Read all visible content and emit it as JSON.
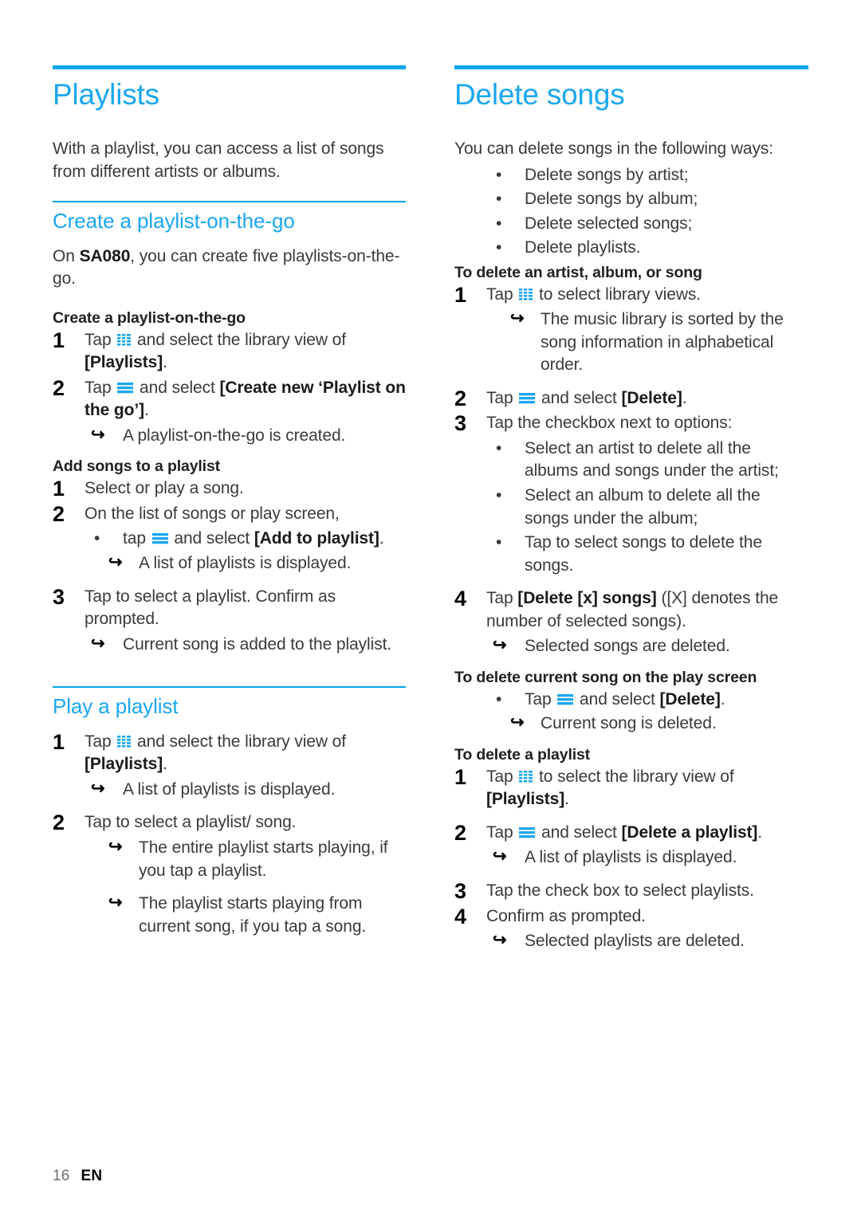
{
  "accent_color": "#00a5ed",
  "heading_color": "#1aa7f0",
  "icons": {
    "grid": "library-views-grid-icon",
    "menu": "options-menu-icon"
  },
  "left_column": {
    "chapter_title": "Playlists",
    "intro": "With a playlist, you can access a list of songs from different artists or albums.",
    "section1": {
      "title": "Create a playlist-on-the-go",
      "lead_pre": "On ",
      "lead_bold": "SA080",
      "lead_post": ", you can create five playlists-on-the-go.",
      "sub1_title": "Create a playlist-on-the-go",
      "sub1_steps": [
        {
          "num": "1",
          "pre": "Tap ",
          "icon": "grid",
          "mid": " and select the library view of ",
          "bold": "[Playlists]",
          "post": "."
        },
        {
          "num": "2",
          "pre": "Tap ",
          "icon": "menu",
          "mid": " and select ",
          "bold": "[Create new ‘Playlist on the go’]",
          "post": "."
        }
      ],
      "sub1_result": "A playlist-on-the-go is created.",
      "sub2_title": "Add songs to a playlist",
      "sub2_step1": "Select or play a song.",
      "sub2_step2": "On the list of songs or play screen,",
      "sub2_bullet": {
        "pre": "tap ",
        "icon": "menu",
        "mid": " and select ",
        "bold": "[Add to playlist]",
        "post": "."
      },
      "sub2_bullet_result": "A list of playlists is displayed.",
      "sub2_step3": "Tap to select a playlist. Confirm as prompted.",
      "sub2_step3_result": "Current song is added to the playlist."
    },
    "section2": {
      "title": "Play a playlist",
      "step1": {
        "num": "1",
        "pre": "Tap ",
        "icon": "grid",
        "mid": " and select the library view of ",
        "bold": "[Playlists]",
        "post": "."
      },
      "step1_result": "A list of playlists is displayed.",
      "step2": "Tap to select a playlist/ song.",
      "step2_result1": "The entire playlist starts playing, if you tap a playlist.",
      "step2_result2": "The playlist starts playing from current song, if you tap a song."
    }
  },
  "right_column": {
    "chapter_title": "Delete songs",
    "intro": "You can delete songs in the following ways:",
    "intro_bullets": [
      "Delete songs by artist;",
      "Delete songs by album;",
      "Delete selected songs;",
      "Delete playlists."
    ],
    "section1": {
      "title": "To delete an artist, album, or song",
      "step1": {
        "num": "1",
        "pre": "Tap ",
        "icon": "grid",
        "mid": " to select library views.",
        "bold": "",
        "post": ""
      },
      "step1_result": "The music library is sorted by the song information in alphabetical order.",
      "step2": {
        "num": "2",
        "pre": "Tap ",
        "icon": "menu",
        "mid": " and select ",
        "bold": "[Delete]",
        "post": "."
      },
      "step3": "Tap the checkbox next to options:",
      "step3_bullets": [
        "Select an artist to delete all the albums and songs under the artist;",
        "Select an album to delete all the songs under the album;",
        "Tap to select songs to delete the songs."
      ],
      "step4": {
        "num": "4",
        "pre": "Tap ",
        "bold": "[Delete [x] songs]",
        "post": " ([X] denotes the number of selected songs)."
      },
      "step4_result": "Selected songs are deleted."
    },
    "section2": {
      "title": "To delete current song on the play screen",
      "bullet": {
        "pre": "Tap ",
        "icon": "menu",
        "mid": " and select ",
        "bold": "[Delete]",
        "post": "."
      },
      "bullet_result": "Current song is deleted."
    },
    "section3": {
      "title": "To delete a playlist",
      "step1": {
        "num": "1",
        "pre": "Tap ",
        "icon": "grid",
        "mid": " to select the library view of ",
        "bold": "[Playlists]",
        "post": "."
      },
      "step2": {
        "num": "2",
        "pre": "Tap ",
        "icon": "menu",
        "mid": " and select ",
        "bold": "[Delete a playlist]",
        "post": "."
      },
      "step2_result": "A list of playlists is displayed.",
      "step3": "Tap the check box to select playlists.",
      "step4": "Confirm as prompted.",
      "step4_result": "Selected playlists are deleted."
    }
  },
  "footer": {
    "page_number": "16",
    "language": "EN"
  }
}
